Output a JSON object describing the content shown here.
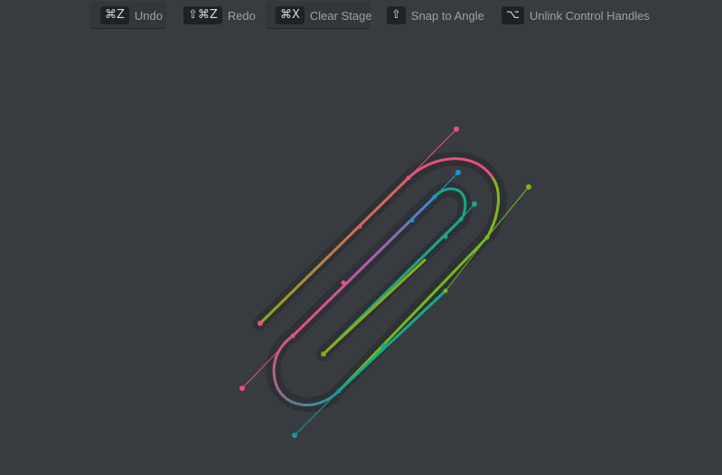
{
  "toolbar": {
    "undo": {
      "key": "⌘Z",
      "label": "Undo"
    },
    "redo": {
      "key": "⇧⌘Z",
      "label": "Redo"
    },
    "clear": {
      "key": "⌘X",
      "label": "Clear Stage"
    },
    "snap": {
      "key": "⇧",
      "label": "Snap to Angle"
    },
    "unlink": {
      "key": "⌥",
      "label": "Unlink Control Handles"
    }
  },
  "colors": {
    "background": "#383c40",
    "pink": "#e8507a",
    "blue": "#1f93d8",
    "teal": "#18a889",
    "lime": "#77b81e",
    "olive": "#8caa1a",
    "cyan": "#149aa0"
  }
}
